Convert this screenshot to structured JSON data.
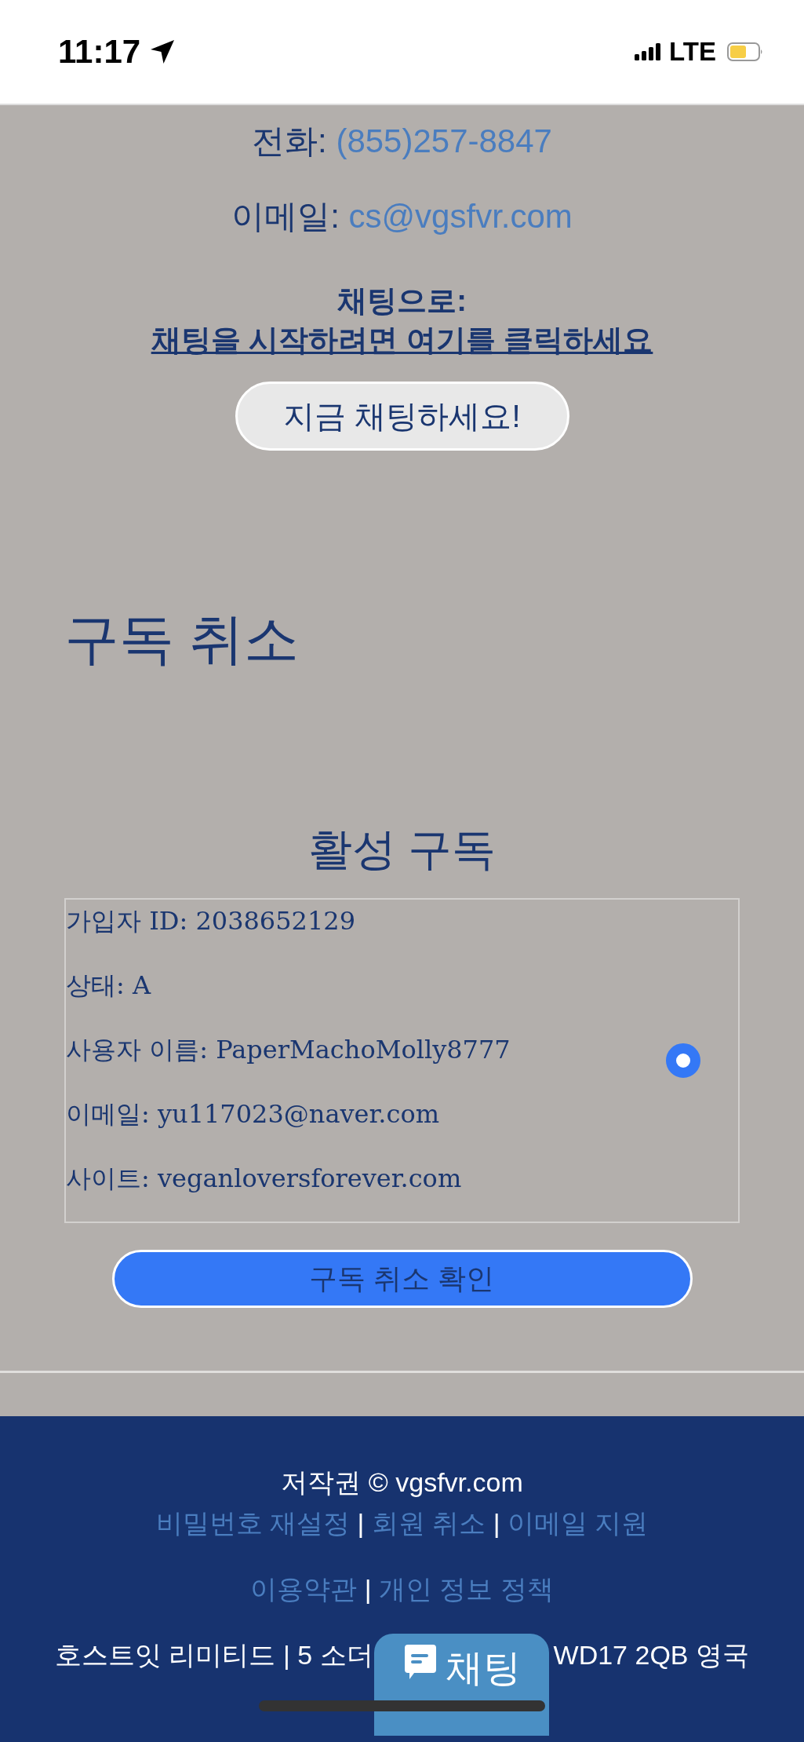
{
  "status_bar": {
    "time": "11:17",
    "network": "LTE"
  },
  "contact": {
    "phone_label": "전화:",
    "phone": "(855)257-8847",
    "email_label": "이메일:",
    "email": "cs@vgsfvr.com",
    "chat_label": "채팅으로:",
    "chat_link": "채팅을 시작하려면 여기를 클릭하세요",
    "chat_button": "지금 채팅하세요!"
  },
  "page_title": "구독 취소",
  "section_title": "활성 구독",
  "subscription": {
    "selected": true,
    "fields": [
      {
        "label": "가입자 ID:",
        "value": "2038652129"
      },
      {
        "label": "상태:",
        "value": "A"
      },
      {
        "label": "사용자 이름:",
        "value": "PaperMachoMolly8777"
      },
      {
        "label": "이메일:",
        "value": "yu117023@naver.com"
      },
      {
        "label": "사이트:",
        "value": "veganloversforever.com"
      }
    ]
  },
  "confirm_button": "구독 취소 확인",
  "footer": {
    "copyright": "저작권 © vgsfvr.com",
    "link_rows": [
      [
        "비밀번호 재설정",
        "회원 취소",
        "이메일 지원"
      ],
      [
        "이용약관",
        "개인 정보 정책"
      ]
    ],
    "separator": "|",
    "address_left": "호스트잇 리미티드 | 5 소더",
    "address_right": "WD17 2QB 영국"
  },
  "chat_widget": {
    "label": "채팅"
  }
}
